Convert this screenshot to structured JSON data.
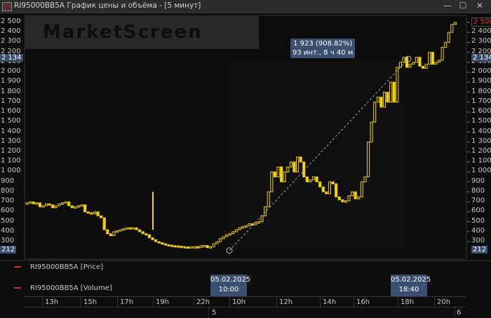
{
  "window": {
    "title": "RI95000BB5A График цены и объёма - [5 минут]",
    "min": "—",
    "max": "☐",
    "close": "✕"
  },
  "logo": "MarketScreen",
  "price_axis": {
    "ticks": [
      "2 500",
      "2 400",
      "2 300",
      "2 200",
      "2 100",
      "2 000",
      "1 900",
      "1 800",
      "1 700",
      "1 600",
      "1 500",
      "1 400",
      "1 300",
      "1 200",
      "1 100",
      "1 000",
      "900",
      "800",
      "700",
      "600",
      "500",
      "400",
      "300"
    ],
    "tick_values": [
      2500,
      2400,
      2300,
      2200,
      2100,
      2000,
      1900,
      1800,
      1700,
      1600,
      1500,
      1400,
      1300,
      1200,
      1100,
      1000,
      900,
      800,
      700,
      600,
      500,
      400,
      300
    ],
    "last_price": "2 500",
    "crosshair_high": "2 134",
    "crosshair_low": "212"
  },
  "measure": {
    "line1": "1 923 (908.82%)",
    "line2": "93 инт., 8 ч 40 м",
    "from_price": 212,
    "to_price": 2134
  },
  "candle_color": "#f5d000",
  "closes": [
    690,
    700,
    680,
    690,
    650,
    660,
    680,
    670,
    640,
    660,
    680,
    690,
    700,
    660,
    640,
    650,
    660,
    670,
    600,
    590,
    580,
    600,
    560,
    540,
    420,
    380,
    360,
    400,
    410,
    420,
    430,
    440,
    430,
    440,
    420,
    400,
    380,
    370,
    340,
    320,
    300,
    290,
    280,
    270,
    265,
    260,
    258,
    255,
    250,
    248,
    245,
    250,
    250,
    240,
    260,
    262,
    240,
    250,
    280,
    300,
    330,
    350,
    370,
    380,
    400,
    420,
    440,
    450,
    460,
    480,
    470,
    490,
    500,
    560,
    650,
    800,
    1000,
    950,
    1050,
    900,
    1000,
    1050,
    1100,
    1000,
    1150,
    1100,
    950,
    900,
    920,
    950,
    900,
    850,
    800,
    780,
    900,
    880,
    750,
    720,
    700,
    710,
    760,
    800,
    730,
    750,
    900,
    950,
    1300,
    1500,
    1700,
    1750,
    1650,
    1800,
    1700,
    1900,
    1700,
    2050,
    2100,
    2150,
    2050,
    2080,
    2100,
    2150,
    2060,
    2040,
    2080,
    2200,
    2080,
    2100,
    2120,
    2250,
    2300,
    2400,
    2480,
    2500
  ],
  "spike": {
    "high": 800,
    "low": 420
  },
  "legends": {
    "price": "RI95000BB5A [Price]",
    "volume": "RI95000BB5A [Volume]"
  },
  "crosshair_dates": [
    {
      "date": "05.02.2025",
      "time": "10:00"
    },
    {
      "date": "05.02.2025",
      "time": "18:40"
    }
  ],
  "time_axis": [
    "13h",
    "15h",
    "17h",
    "19h",
    "22h",
    "10h",
    "12h",
    "14h",
    "16h",
    "18h",
    "20h"
  ],
  "date_axis": [
    "5",
    "6"
  ]
}
